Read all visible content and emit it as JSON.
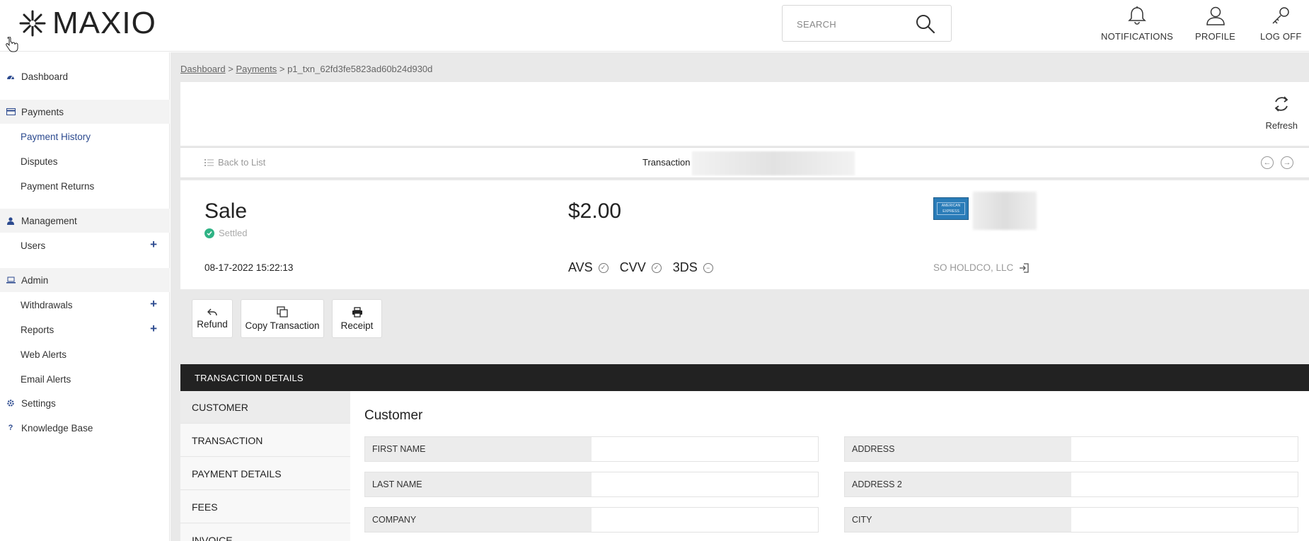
{
  "header": {
    "logo_text": "MAXIO",
    "search_placeholder": "SEARCH",
    "notifications_label": "NOTIFICATIONS",
    "profile_label": "PROFILE",
    "logoff_label": "LOG OFF"
  },
  "sidebar": {
    "dashboard": "Dashboard",
    "payments": "Payments",
    "payment_history": "Payment History",
    "disputes": "Disputes",
    "payment_returns": "Payment Returns",
    "management": "Management",
    "users": "Users",
    "admin": "Admin",
    "withdrawals": "Withdrawals",
    "reports": "Reports",
    "web_alerts": "Web Alerts",
    "email_alerts": "Email Alerts",
    "settings": "Settings",
    "knowledge_base": "Knowledge Base",
    "plus": "+"
  },
  "breadcrumb": {
    "dashboard": "Dashboard",
    "sep": " > ",
    "payments": "Payments",
    "current": "p1_txn_62fd3fe5823ad60b24d930d"
  },
  "toolbar": {
    "refresh_label": "Refresh",
    "back_label": "Back to List",
    "transaction_label": "Transaction"
  },
  "summary": {
    "type": "Sale",
    "status": "Settled",
    "date": "08-17-2022 15:22:13",
    "amount": "$2.00",
    "avs": "AVS",
    "cvv": "CVV",
    "tds": "3DS",
    "card_brand": "AMERICAN EXPRESS",
    "merchant": "SO HOLDCO, LLC"
  },
  "actions": {
    "refund": "Refund",
    "copy": "Copy Transaction",
    "receipt": "Receipt"
  },
  "details": {
    "bar_title": "TRANSACTION DETAILS",
    "tabs": [
      "CUSTOMER",
      "TRANSACTION",
      "PAYMENT DETAILS",
      "FEES",
      "INVOICE"
    ],
    "section_title": "Customer",
    "left_fields": [
      "FIRST NAME",
      "LAST NAME",
      "COMPANY"
    ],
    "right_fields": [
      "ADDRESS",
      "ADDRESS 2",
      "CITY"
    ]
  },
  "colors": {
    "accent": "#2c4a8f",
    "settled": "#2fb385",
    "amex": "#2a7cb8",
    "details_bar": "#222222"
  }
}
